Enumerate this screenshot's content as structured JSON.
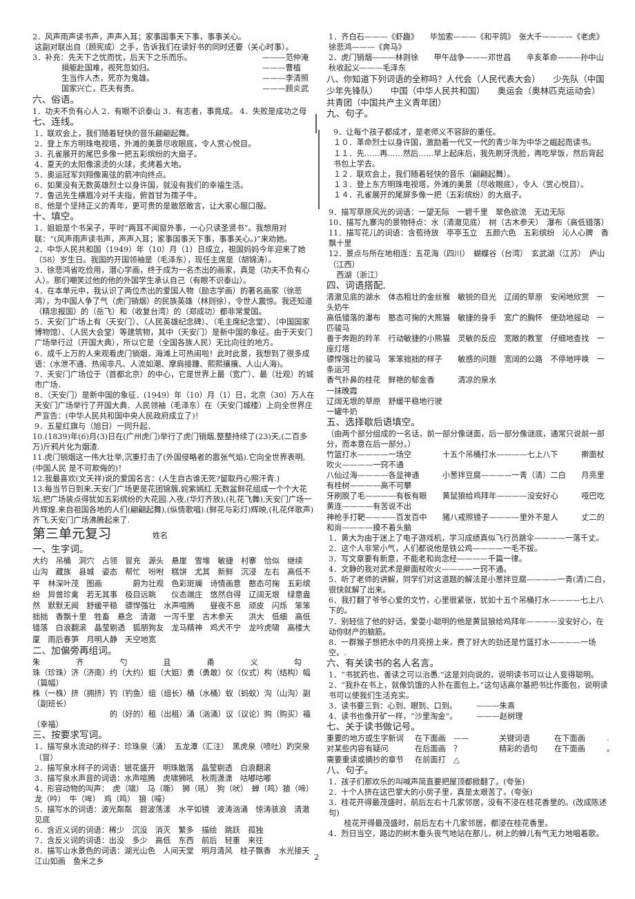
{
  "left": {
    "intro": [
      "2．风声雨声读书声，声声入耳；家事国事天下事，事事关心。",
      "这副对联出自（顾宪成）之手，告诉我们在读好书的同时还要（关心时事）。"
    ],
    "quotes_label": "3．补充：",
    "quotes": [
      {
        "text": "先天下之忧而忧，后天下之乐而乐。",
        "author": "———范仲淹"
      },
      {
        "text": "捐躯赴国难，视死忽如归。",
        "author": "———曹植"
      },
      {
        "text": "生当作人杰，死亦为鬼雄。",
        "author": "———李清照"
      },
      {
        "text": "国家兴亡，匹夫有责。",
        "author": "———顾炎武"
      }
    ],
    "sec6_title": "六、俗语。",
    "sec6_text": "1．功夫不负有心人 2．有眼不识泰山 3．有志者，事竟成。 4．失败是成功之母",
    "sec7_title": "七、连线。",
    "sec7_items": [
      "1．联欢会上，我们随着轻快的音乐翩翩起舞。",
      "2．登上东方明珠电视塔，外滩的美景尽收眼底，令人赏心悦目。",
      "3．孔雀展开的尾巴多像一把五彩缤纷的大扇子。",
      "4．夏天的太阳像滚烫的火球，炙烤着大地。",
      "5．奥运冠军刘翔像离弦的箭冲向终点。",
      "6．如果没有无数英雄烈士以身许国，就没有我们的幸福生活。",
      "7．鲁迅先生横眉冷对千夫指，俯首甘为孺子牛。",
      "8．他是个坚持正义的青年，更可贵的是敢怒敢言，让大家心服口服。"
    ],
    "sec10_title": "十、填空。",
    "sec10_items": [
      "1．姐姐是个书呆子，平时“两耳不闻窗外事，一心只读圣贤书”。我想用对联：“(风声雨声读书声，声声入耳；家事国事天下事，事事关心。)”来劝她。",
      "2．中华人民共和国（1949）年（10）月（1）日成立，祖国妈妈今年迎来了她（58）岁生日。我国的开国领袖是（毛泽东），现任主席是（胡锦涛）。",
      "3．徐悲鸿省吃俭用，潜心学画，终于成为一名杰出的画家，真是（功夫不负有心人）。那们嘲笑过他的他的外国学生承认自己（有眼不识泰山）。",
      "4．在本单元中，我认识了两位杰出的爱国人物（励志学画）的著名画家（徐悲鸿），为中国人争了气（虎门销烟）的民族英雄（林则徐），令世人震惊。我还知道（精忠报国）的（岳飞）和（收复台湾）的（郑成功）都非常爱国。",
      "5．天安门广场上有（天安门）、（人民英雄纪念碑）、（毛主席纪念堂）、（中国国家博物馆）、（人民大会堂）等建筑物，其中（天安门）是新中国的象征。由于天安门广场举行过（开国大典），所以它是（全国各族人民）无比向往的地方。",
      "6．成千上万的人来观看虎门销烟，海滩上可热闹啦！此时此景，我想到了很多成语：(水泄不通、热闹非凡、人流如潮、摩肩接踵、熙熙攘攘、人山人海)。",
      "7．天安门广场位于（首都北京）的中心，它是世界上最（宽广）、最（壮观）的城市广场．",
      "8．（天安门）是新中国的象征．(1949）年（10）月（1）日，北京（30）万人在天安门广场举行了开国大典．人民领袖（毛泽东）在（天安门城楼）上向全世界庄严宣告：(中华人民共和国中央人民政府成立了)！",
      "9．五星红旗与（旭日）一同升起．",
      "10.(1839)年(6)月(3)日在(广州虎门)举行了虎门销烟,整整持续了(23)天,(二百多万)斤鸦片化为烟渣.",
      "11.虎门销烟这一伟大壮举,沉重打击了(外国侵略者的嚣张气焰).它向全世界表明,(中国人民 是不可欺侮的)！",
      "12.我最喜欢(文天祥)说的爱国名言：(人生自古谁无死?留取丹心照汗青.)",
      "13.每当节日到来,天安门广场更是花团锦簇,姹紫嫣红.无数盆鲜花组成一个个大花坛,把广场装点得犹如五彩缤纷的大花园.入夜,(华灯齐放),(礼花飞舞),天安门广场一片辉煌.来自祖国各地的人们(翩翩起舞),(纵情歌唱).(鲜花与彩灯)辉映,(礼花伴歌声)齐飞,天安门广场沸腾起来了."
    ],
    "unit3_title": "第三单元复习",
    "name_label": "姓名",
    "u1_title": "一、生字词。",
    "u1_text": "大约　吊桶　洞穴　占领　冒充　源头　悬崖　雪堆　敏捷　村寨　恰似　继续　山沟　藏族　县城　姿态　帮忙　吩咐　糕饼　尤其　新鲜　沉浸　左右　高低不平　林深叶茂　图画　　　　蔚为壮观　色彩斑斓　诗情画意　憨态可掬　五彩缤纷　异兽珍禽　若无其事　极目远眺　　仪态端庄　悠然自得　辽阔无垠　绿意盎然　默默无闻　舒缓平稳　骠悍强壮　水声喧腾　　昼夜不息　顽皮　闪烁　笨笨拙拙　香飘十里　牲畜　悬念　清澈　一泻千里　古木参天　　洪大　低细　高低错落　白浪翻滚　晶莹剔透　狐朋狗友　龙马精神　鸡犬不宁　龙吟虎啸　高楼大厦　雨后春笋　月明人静　天空地宽",
    "u2_title": "二、加偏旁再组词。",
    "u2_radicals": [
      "朱",
      "齐",
      "勺",
      "且",
      "甬",
      "义",
      "勾"
    ],
    "u2_lines": [
      "珠（珍珠）济（济南）约（大约）姐（大姐）勇（勇敢）仪（仪式）构（结构）幅（篇幅）",
      "株（一株）挤（拥挤）钓（钓鱼）组（组长）桶（水桶）蚁（蚂蚁）沟（山沟）副（副班长）",
      "　　　　　　　　　　的（好的）租（出租）涌（汹涌）议（议论）购（购买）福（幸福）"
    ],
    "u3_title": "三、按要求写词。",
    "u3_items": [
      "1．描写泉水流动的样子：珍珠泉（涌）　五龙潭（汇注）　黑虎泉（喷吐）趵突泉（冒）",
      "2．描写泉水样子的词语：银花盛开　明珠散落　晶莹剔透　白浪翻滚",
      "3．描写泉水声音的词语：水声喧腾　虎啸狮吼　秋雨潇潇　咕嘟咕嘟",
      "4．形容动物的叫声：　虎（啸）　马（嘶）　狮（吼）　狗（吠）　蝉（鸣）猿（啼）　　　　　　　龙（吟）　牛（哞）　鸡（鸣）　狼（嚎）",
      "5．描写水的词语：波光粼粼　碧波荡漾　水平如镜　波涛汹涌　惊涛骇浪　清澈见底",
      "6．含近义词的词语：稀少　沉没　消灭　繁多　描绘　跳跃　孤独",
      "7．含反义词的词语：出没　多少　高低　东西　前后　轻重　来往",
      "8．描写山水景色的词语：湖光山色　人间天堂　明月清风　桂子飘香　水光接天　江山如画　鱼米之乡"
    ]
  },
  "right": {
    "top_items": [
      "1．齐白石———《虾趣》　　毕加索———《和平鸽》　张大千————《老虎》徐悲鸿———《奔马》",
      "2．虎门销烟———林则徐　　甲午战争———邓世昌　　辛亥革命———孙中山　秋收起义———毛泽东"
    ],
    "sec8_text": "八、你知道下列词语的全称吗？人代会（人民代表大会）　　少先队（中国少年先锋队）　　中国（中华人民共和国）　　奥运会（奥林匹克运动会）　共青团（中国共产主义青年团）",
    "sec9_title": "九、句子。",
    "sec9_items": [
      "9．让每个孩子都成才，是老师义不容辞的重任。",
      "１０．革命烈士以身许国，激励着一代又一代的青少年为中华之崛起而读书。",
      "１１．先……再……然后……早上起床后，我先刷牙洗脸，再吃早饭，然后背起书包上学去。",
      "１２．联欢会上，我们随着轻快的音乐（翩翩起舞）。",
      "１３．登上东方明珠电视塔，外滩的美景（尽收眼底），令人（赏心悦目）。",
      "１４．孔雀展开的尾屏多像一把（五彩缤纷）的大扇子。"
    ],
    "mid_items": [
      "9．描写草原风光的词语：一望无际　一碧千里　翠色欲流　无边无际",
      "10．描写九寨沟的景物特点：水（清澈见底）　树（古木参天）　瀑布（高低错落）",
      "11．描写花儿的词语：含苞待放　亭亭玉立　五颜六色　五彩缤纷　沁人心脾　香飘十里",
      "12．景点与所在地相连：五花海（四川）　蝴蝶谷（台湾）　玄武湖（江苏）　庐山（江西）",
      "　西湖（浙江）"
    ],
    "sec4_title": "四、词语搭配.",
    "sec4_items": [
      "清澈见底的湖水　体态粗壮的金丝猴　敏锐的目光　辽阔的草原　安闲地欣赏　一头奶牛",
      "高低错落的瀑布　憨态可掬的大熊猫　敏捷的身手　宽广的胸怀　使劲地摇动　一匹骏马",
      "善于奔跑的羚羊　行动敏捷的小熊猫　灵敏的反应　宽敞的教室　仔细地查找　一座灯塔",
      "骠悍强壮的骏马　笨笨拙拙的样子　　敏感的问题　宽阔的公路　不停地呼唤　一条运河",
      "香气扑鼻的桂花　鲜艳的郁金香　　　清凉的泉水",
      "一抹晚霞",
      "辽阔无垠的草原　舒缓平稳地行驶",
      "一罐牛奶"
    ],
    "sec5_title": "五、选择歇后语填空。",
    "sec5_intro": "（由两个部分组成的一名话，前一部分像谜面，后一部分像谜底，通常只说前一部分，而本意在后一部分。）",
    "sec5_pairs": [
      "竹篮打水————一场空　　　　十五个吊桶打水————七上八下　　　擀面杖吹火————一窍不通",
      "八仙过海————各显神通　　　小葱拌豆腐————一青（清）二白　　月亮里有桂树————高不可攀",
      "牙刷脱了毛————有板有眼　　黄鼠狼给鸡拜年————没安好心　　　哑巴吃黄连————有苦说不出",
      "神枪手打靶————百发百中　　猪八戒照镜子————里外不是人　　　丈二的和尚————摸不着头脑"
    ],
    "sec5_items": [
      "1．黄大为由于迷上了电子游戏机，学习成绩真似飞行员跳伞————一落千丈。",
      "2．这个人非常小气，人们都说他是铁公鸡————一毛不拔。",
      "3．写文章要有新意，不能老和尚念经————千篇一律。",
      "4．文静的我对武术是擀面杖吹火————一窍不通。",
      "5．听了老师的讲解，同学们对这道题的解法是小葱拌豆腐————一青(清)二白，很快就解了出来。",
      "6．我打翻了爷爷心爱的文竹，心里很紧张，犹如十五个吊桶打水————七上八下的。",
      "7．别轻信了他的好话，爱耍小聪明的他是黄鼠狼给鸡拜年————没安好心，在动你财产的脑筋。",
      "8．一群猴子想把水中的月亮捞上来，费了好大的劲还是竹篮打水————一场空。."
    ],
    "sec6_title": "六、有关读书的名人名言。",
    "sec6_items": [
      "1．“书犹药也，善读之可以治愚.”这是刘向说的，说明读书可以让人变得聪明。",
      "2．“我扑在书上，就像饥饿的人扑在面包上。”这句话高尔基把书比作面包，说明读书可以使我们生活充实。",
      "3．读书要三到：心到、眼到、口到。　　　———朱熹",
      "4．读书也像开矿一样，“沙里淘金”。　　　———赵树理"
    ],
    "sec7_title": "七、关于读书做记号。",
    "sec7_rows": [
      [
        "重要的地方或生字新词",
        "在下面画",
        "——",
        "关键词语",
        "在下面画",
        "."
      ],
      [
        "对某些内容有疑问",
        "在后面画",
        "？",
        "精彩的语句",
        "在下面画",
        "。"
      ],
      [
        "需要重读或摘抄的章节",
        "在前面打",
        "△",
        "",
        "",
        ""
      ]
    ],
    "sec8b_title": "八、句子。",
    "sec8b_items": [
      "1．孩子们那欢乐的叫喊声简直要把屋顶都掀翻了。(夸张)",
      "2．十个人挤在这巴掌大的小房子里，真是太艰苦了。(夸张)",
      "3．桂花开得最茂盛时，前后左右十几家邻居，没有不浸在桂花香里的。(改成陈述句)",
      "　　桂花开得最茂盛时，前后左右十几家邻居，都浸在桂花香里。",
      "4．烈日当空，路边的树木垂头丧气地站在那儿，树上的蝉儿有气无力地唱着歌。"
    ]
  },
  "page_number": "2"
}
